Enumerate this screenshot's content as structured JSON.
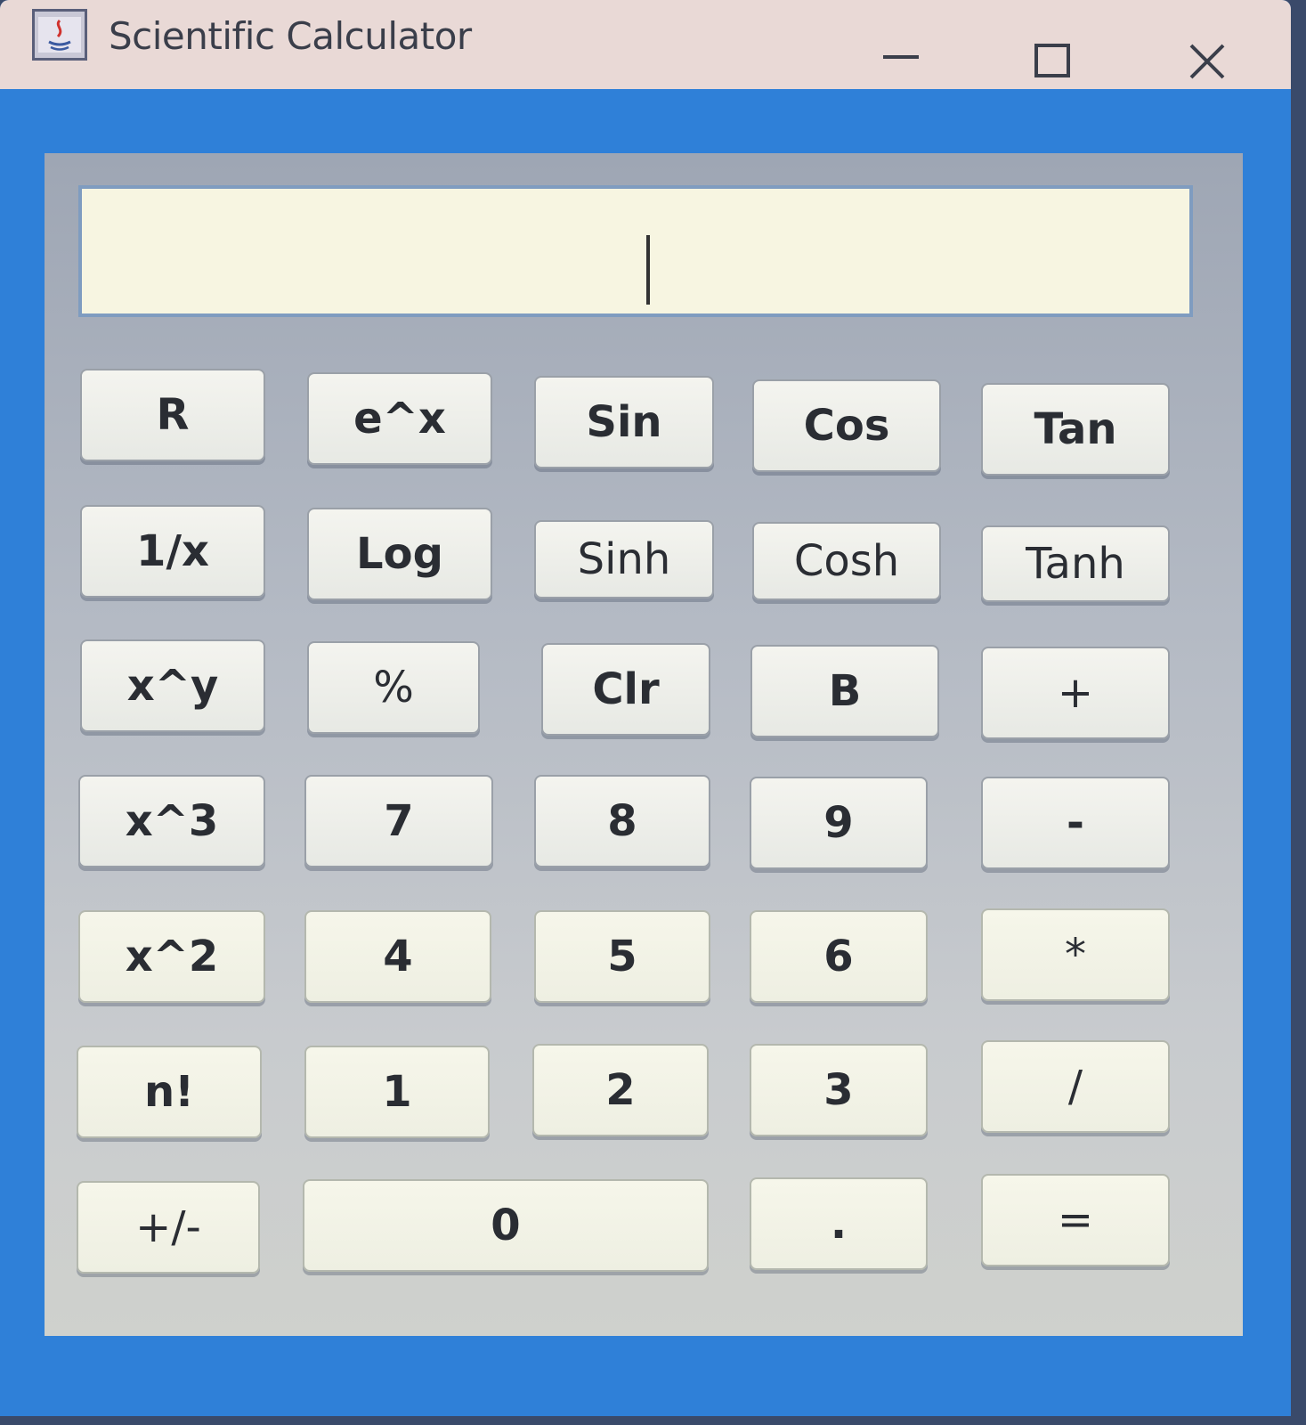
{
  "window": {
    "title": "Scientific Calculator",
    "accent_color": "#2f80d8",
    "titlebar_color": "#e9d9d6"
  },
  "controls": {
    "minimize_icon": "minimize-icon",
    "maximize_icon": "maximize-icon",
    "close_icon": "close-icon"
  },
  "display": {
    "value": ""
  },
  "keys": {
    "r0": [
      "R",
      "e^x",
      "Sin",
      "Cos",
      "Tan"
    ],
    "r1": [
      "1/x",
      "Log",
      "Sinh",
      "Cosh",
      "Tanh"
    ],
    "r2": [
      "x^y",
      "%",
      "Clr",
      "B",
      "+"
    ],
    "r3": [
      "x^3",
      "7",
      "8",
      "9",
      "-"
    ],
    "r4": [
      "x^2",
      "4",
      "5",
      "6",
      "*"
    ],
    "r5": [
      "n!",
      "1",
      "2",
      "3",
      "/"
    ],
    "r6": [
      "+/-",
      "0",
      ".",
      "="
    ]
  }
}
